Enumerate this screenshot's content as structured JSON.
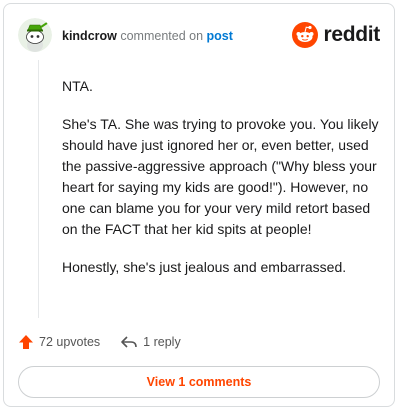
{
  "header": {
    "username": "kindcrow",
    "action_text": "commented on",
    "target_link": "post",
    "logo_text": "reddit",
    "brand_color": "#ff4500"
  },
  "comment": {
    "paragraphs": [
      "NTA.",
      "She's TA. She was trying to provoke you. You likely should have just ignored her or, even better, used the passive-aggressive approach (\"Why bless your heart for saying my kids are good!\"). However, no one can blame you for your very mild retort based on the FACT that her kid spits at people!",
      "Honestly, she's just jealous and embarrassed."
    ]
  },
  "actions": {
    "upvotes_label": "72 upvotes",
    "upvote_icon": "upvote-arrow-icon",
    "reply_label": "1 reply",
    "reply_icon": "reply-arrow-icon"
  },
  "footer": {
    "view_button_label": "View 1 comments"
  }
}
